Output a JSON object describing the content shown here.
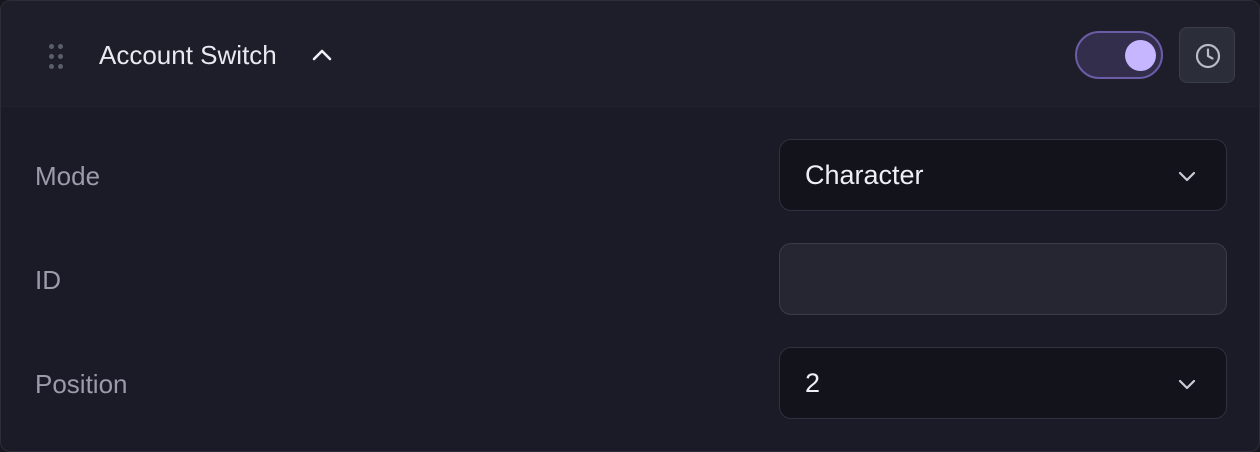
{
  "header": {
    "title": "Account Switch",
    "enabled": true,
    "icons": {
      "drag": "drag-handle-icon",
      "collapse": "chevron-up-icon",
      "history": "clock-icon"
    }
  },
  "fields": {
    "mode": {
      "label": "Mode",
      "value": "Character"
    },
    "id": {
      "label": "ID",
      "value": "",
      "placeholder": ""
    },
    "position": {
      "label": "Position",
      "value": "2"
    }
  },
  "colors": {
    "panel_bg": "#1a1b26",
    "header_bg": "#1d1e29",
    "accent": "#c6b5ff",
    "toggle_track": "#322e4b",
    "label_text": "#9a9cab",
    "value_text": "#eef0f6"
  }
}
